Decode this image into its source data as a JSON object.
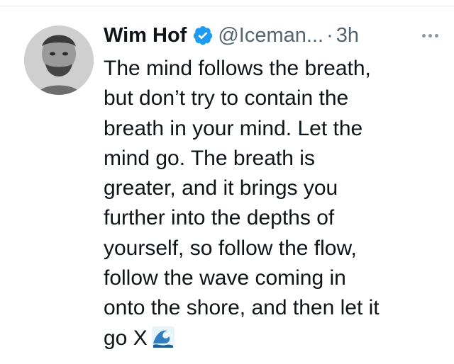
{
  "tweet": {
    "author_name": "Wim Hof",
    "handle": "@Iceman...",
    "separator": "·",
    "time": "3h",
    "text": "The mind follows the breath,\nbut don’t try to contain the\nbreath in your mind. Let the\nmind go. The breath is\ngreater, and it brings you\nfurther into the depths of\nyourself, so follow the flow,\nfollow the wave coming in\nonto the shore, and then let it\ngo X",
    "trailing_emoji": "wave-emoji"
  },
  "icons": {
    "verified": "verified-badge-icon",
    "more": "more-options-icon",
    "wave": "wave-icon"
  },
  "colors": {
    "verified": "#1d9bf0",
    "secondary_text": "#536471",
    "primary_text": "#0f1419"
  }
}
